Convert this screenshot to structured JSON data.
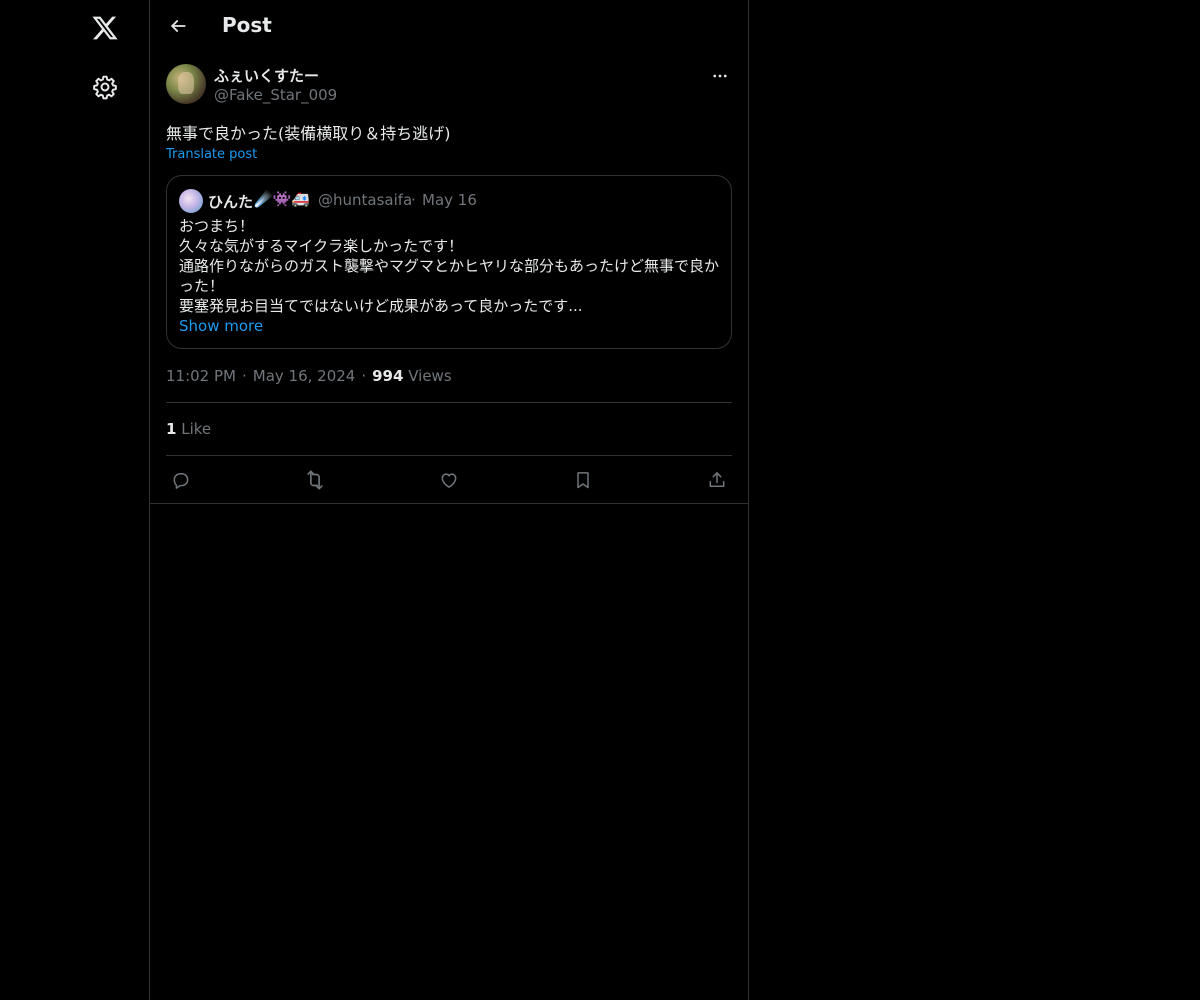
{
  "header": {
    "title": "Post"
  },
  "post": {
    "author_name": "ふぇいくすたー",
    "author_handle": "@Fake_Star_009",
    "text": "無事で良かった(装備横取り＆持ち逃げ)",
    "translate_label": "Translate post",
    "quote": {
      "author_name": "ひんた",
      "author_emojis": "☄️👾🚑",
      "author_handle": "@huntasaifa",
      "separator": "·",
      "date": "May 16",
      "lines": [
        "おつまち！",
        "久々な気がするマイクラ楽しかったです！",
        "通路作りながらのガスト襲撃やマグマとかヒヤリな部分もあったけど無事で良か",
        "った！",
        "要塞発見お目当てではないけど成果があって良かったです..."
      ],
      "show_more_label": "Show more"
    },
    "time": "11:02 PM",
    "date": "May 16, 2024",
    "separator": "·",
    "views_count": "994",
    "views_label": "Views",
    "like_count": "1",
    "like_label": "Like"
  },
  "icons": {
    "logo": "x-logo-icon",
    "settings": "gear-icon",
    "back": "arrow-left-icon",
    "more": "more-horizontal-icon",
    "reply": "reply-icon",
    "repost": "repost-icon",
    "like": "heart-icon",
    "bookmark": "bookmark-icon",
    "share": "share-icon"
  },
  "colors": {
    "background": "#000000",
    "text_primary": "#e7e9ea",
    "text_secondary": "#71767b",
    "accent": "#1d9bf0",
    "border": "#2f3336"
  }
}
